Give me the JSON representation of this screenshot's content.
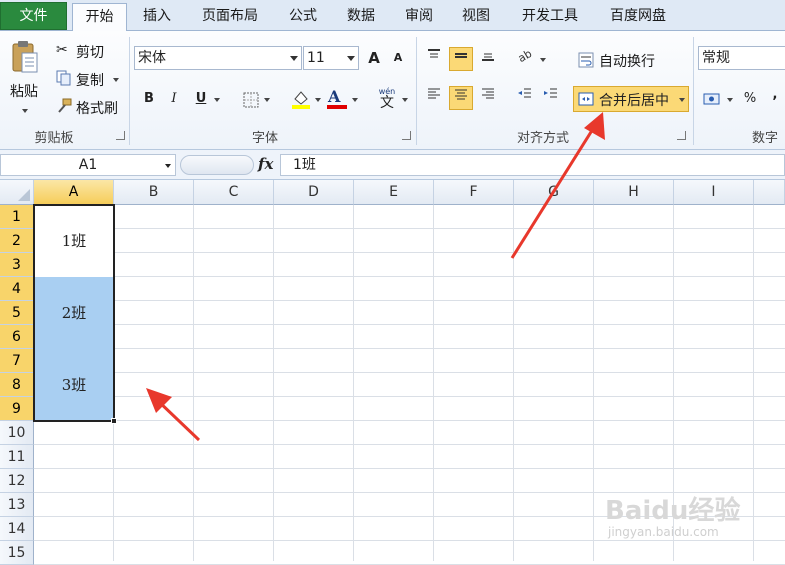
{
  "tabs": [
    {
      "label": "文件",
      "state": "file"
    },
    {
      "label": "开始",
      "state": "active"
    },
    {
      "label": "插入",
      "state": ""
    },
    {
      "label": "页面布局",
      "state": ""
    },
    {
      "label": "公式",
      "state": ""
    },
    {
      "label": "数据",
      "state": ""
    },
    {
      "label": "审阅",
      "state": ""
    },
    {
      "label": "视图",
      "state": ""
    },
    {
      "label": "开发工具",
      "state": ""
    },
    {
      "label": "百度网盘",
      "state": ""
    }
  ],
  "clipboard": {
    "paste": "粘贴",
    "cut": "剪切",
    "copy": "复制",
    "format_painter": "格式刷",
    "group": "剪贴板"
  },
  "font": {
    "name": "宋体",
    "size": "11",
    "bold": "B",
    "italic": "I",
    "underline": "U",
    "group": "字体",
    "grow": "A",
    "shrink": "A",
    "phonetic_top": "wén",
    "phonetic": "文"
  },
  "alignment": {
    "wrap": "自动换行",
    "merge": "合并后居中",
    "group": "对齐方式"
  },
  "number": {
    "format": "常规",
    "percent": "%",
    "comma": ",",
    "group": "数字"
  },
  "formula_bar": {
    "name_box": "A1",
    "fx": "fx",
    "content": "1班"
  },
  "columns": [
    "A",
    "B",
    "C",
    "D",
    "E",
    "F",
    "G",
    "H",
    "I"
  ],
  "rows": [
    "1",
    "2",
    "3",
    "4",
    "5",
    "6",
    "7",
    "8",
    "9",
    "10",
    "11",
    "12",
    "13",
    "14",
    "15"
  ],
  "cells": [
    {
      "text": "1班",
      "fill": "#ffffff"
    },
    {
      "text": "2班",
      "fill": "#a9cff2"
    },
    {
      "text": "3班",
      "fill": "#a9cff2"
    }
  ],
  "colors": {
    "accent": "#f8d46a",
    "highlight_yellow": "#ffff00",
    "font_red": "#e00000",
    "arrow": "#e8382c"
  },
  "watermark": {
    "brand": "Baidu经验",
    "url": "jingyan.baidu.com"
  }
}
